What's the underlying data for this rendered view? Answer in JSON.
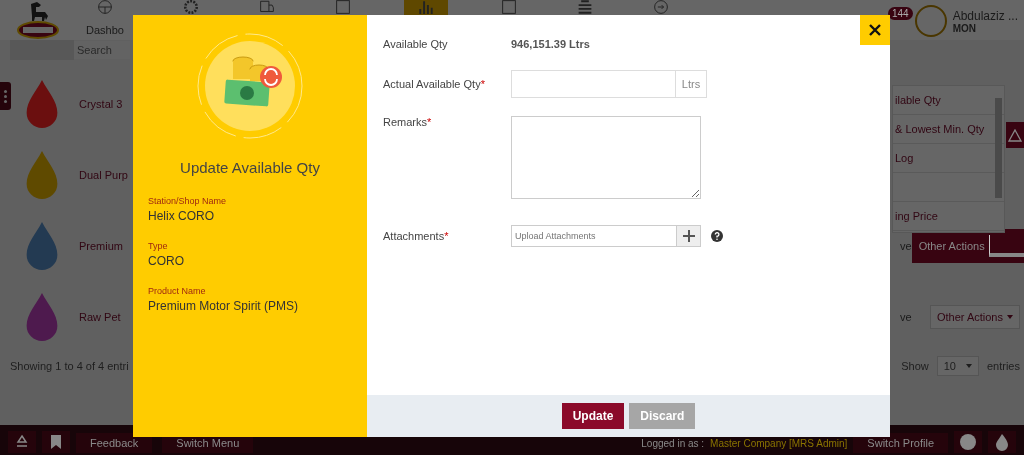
{
  "header": {
    "nav_items": [
      {
        "label": "Dashbo",
        "selected": false
      },
      {
        "selected": false
      },
      {
        "selected": false
      },
      {
        "selected": false
      },
      {
        "selected": true
      },
      {
        "selected": false
      },
      {
        "selected": false
      },
      {
        "selected": false
      }
    ],
    "notification_count": "144",
    "user": {
      "name": "Abdulaziz ...",
      "role": "MON"
    }
  },
  "search": {
    "placeholder": "Search"
  },
  "products": [
    {
      "name": "Crystal 3",
      "color": "#6b0f0f"
    },
    {
      "name": "Dual Purp",
      "color": "#5f4a00"
    },
    {
      "name": "Premium",
      "color": "#233a52",
      "action_prefix": "ve",
      "actions": {
        "label": "Other Actions",
        "menu_open": true
      }
    },
    {
      "name": "Raw Pet",
      "color": "#4e1a4e",
      "action_prefix": "ve",
      "actions": {
        "label": "Other Actions",
        "menu_open": false
      }
    }
  ],
  "actions_menu": {
    "items": [
      {
        "kind": "action",
        "label": "ilable Qty"
      },
      {
        "kind": "action",
        "label": "& Lowest Min. Qty"
      },
      {
        "kind": "action",
        "label": "Log"
      },
      {
        "kind": "blank"
      },
      {
        "kind": "action",
        "label": "ing Price"
      }
    ]
  },
  "table_footer": {
    "info": "Showing 1 to 4 of 4 entri",
    "show_label": "Show",
    "page_size": "10",
    "entries_label": "entries"
  },
  "footer": {
    "feedback": "Feedback",
    "switch_menu": "Switch Menu",
    "logged_in_label": "Logged in as :",
    "company": "Master Company [MRS Admin]",
    "switch_profile": "Switch Profile"
  },
  "modal": {
    "title": "Update Available Qty",
    "details": [
      {
        "label": "Station/Shop Name",
        "value": "Helix CORO"
      },
      {
        "label": "Type",
        "value": "CORO"
      },
      {
        "label": "Product Name",
        "value": "Premium Motor Spirit (PMS)"
      }
    ],
    "fields": [
      {
        "kind": "readonly",
        "label": "Available Qty",
        "value": "946,151.39 Ltrs"
      },
      {
        "kind": "number",
        "label": "Actual Available Qty",
        "required_mark": "*",
        "unit": "Ltrs"
      },
      {
        "kind": "textarea",
        "label": "Remarks",
        "required_mark": "*"
      },
      {
        "kind": "upload",
        "label": "Attachments",
        "required_mark": "*",
        "placeholder": "Upload Attachments"
      }
    ],
    "buttons": [
      {
        "label": "Update",
        "kind": "primary"
      },
      {
        "label": "Discard",
        "kind": "secondary"
      }
    ]
  }
}
